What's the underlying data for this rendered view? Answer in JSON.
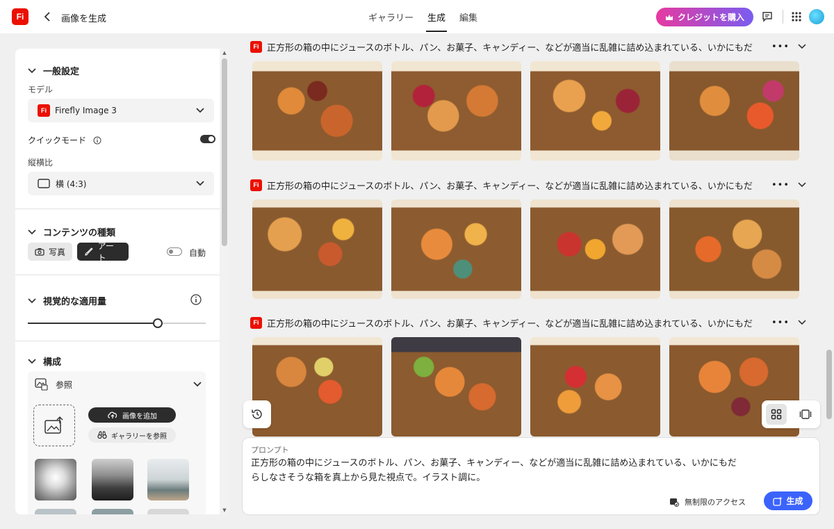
{
  "app": {
    "logo_text": "Fi",
    "page_title": "画像を生成"
  },
  "nav": {
    "tabs": [
      {
        "label": "ギャラリー"
      },
      {
        "label": "生成"
      },
      {
        "label": "編集"
      }
    ]
  },
  "header": {
    "buy_credits_label": "クレジットを購入"
  },
  "panel": {
    "general": {
      "title": "一般設定",
      "model_label": "モデル",
      "model_value": "Firefly Image 3",
      "quick_mode_label": "クイックモード",
      "aspect_label": "縦横比",
      "aspect_value": "横 (4:3)"
    },
    "content_type": {
      "title": "コンテンツの種類",
      "photo_label": "写真",
      "art_label": "アート",
      "auto_label": "自動"
    },
    "visual_intensity": {
      "title": "視覚的な適用量",
      "value_fraction": 0.73
    },
    "composition": {
      "title": "構成",
      "reference_label": "参照",
      "add_image_label": "画像を追加",
      "browse_gallery_label": "ギャラリーを参照"
    }
  },
  "results": {
    "rows": [
      {
        "prompt": "正方形の箱の中にジュースのボトル、パン、お菓子、キャンディー、などが適当に乱雑に詰め込まれている、いかにもだ"
      },
      {
        "prompt": "正方形の箱の中にジュースのボトル、パン、お菓子、キャンディー、などが適当に乱雑に詰め込まれている、いかにもだ"
      },
      {
        "prompt": "正方形の箱の中にジュースのボトル、パン、お菓子、キャンディー、などが適当に乱雑に詰め込まれている、いかにもだ"
      }
    ],
    "more_label": "•••"
  },
  "prompt_box": {
    "label": "プロンプト",
    "text": "正方形の箱の中にジュースのボトル、パン、お菓子、キャンディー、などが適当に乱雑に詰め込まれている、いかにもだらしなさそうな箱を真上から見た視点で。イラスト調に。",
    "unlimited_label": "無制限のアクセス",
    "generate_label": "生成"
  },
  "colors": {
    "brand": "#eb1000",
    "generate": "#3b63fb",
    "buy_gradient_start": "#e63aa0",
    "buy_gradient_end": "#7a5cf0"
  }
}
